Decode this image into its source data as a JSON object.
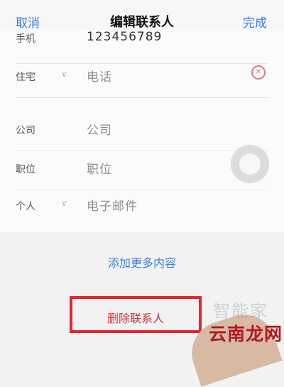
{
  "header": {
    "cancel_label": "取消",
    "title": "编辑联系人",
    "done_label": "完成"
  },
  "fields": [
    {
      "label": "手机",
      "value": "123456789"
    },
    {
      "label": "住宅",
      "value": "电话"
    },
    {
      "label": "公司",
      "value": "公司"
    },
    {
      "label": "职位",
      "value": "职位"
    },
    {
      "label": "个人",
      "value": "电子邮件"
    }
  ],
  "add_more_label": "添加更多内容",
  "delete_contact_label": "删除联系人",
  "watermarks": {
    "zhixiejia": "智能家",
    "yunnanlong": "云南龙网"
  },
  "colors": {
    "accent": "#3a7de0",
    "delete": "#d5343a",
    "highlight_box": "#e8242c"
  }
}
